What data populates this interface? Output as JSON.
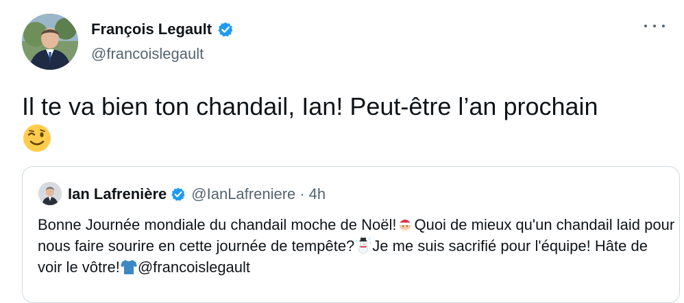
{
  "tweet": {
    "author_name": "François Legault",
    "author_handle": "@francoislegault",
    "text": "Il te va bien ton chandail, Ian! Peut-être l’an prochain",
    "emoji": "winking-face",
    "more_icon": "more-horizontal-icon"
  },
  "quoted_tweet": {
    "author_name": "Ian Lafrenière",
    "author_handle": "@IanLafreniere",
    "separator": "·",
    "time": "4h",
    "text_parts": [
      "Bonne Journée mondiale du chandail moche de Noël!",
      "Quoi de mieux qu'un chandail laid pour nous faire sourire en cette journée de tempête?",
      "Je me suis sacrifié pour l'équipe! Hâte de voir le vôtre!",
      "@francoislegault"
    ],
    "emojis": [
      "santa-claus",
      "snowman",
      "t-shirt"
    ]
  },
  "colors": {
    "text": "#0f1419",
    "secondary": "#536471",
    "verified": "#1d9bf0",
    "border": "#cfd9de"
  }
}
